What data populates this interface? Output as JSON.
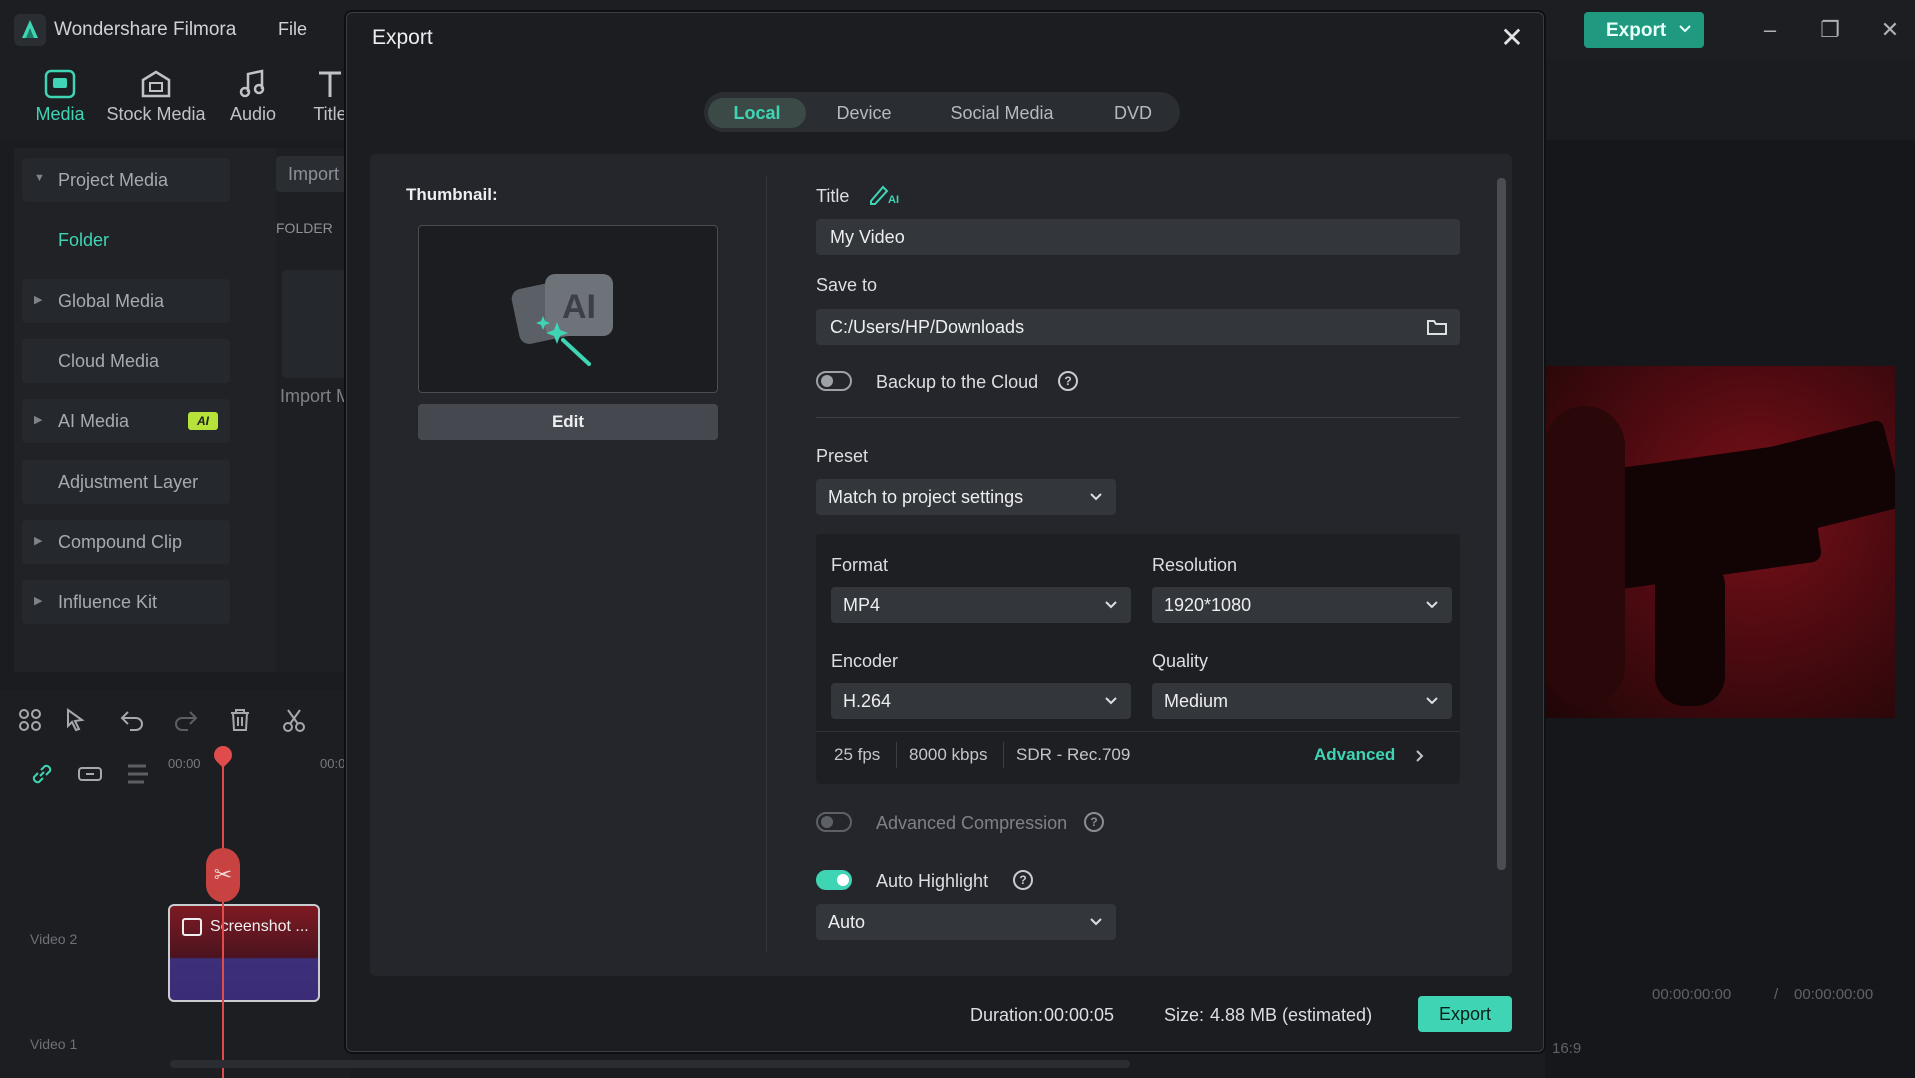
{
  "app": {
    "title": "Wondershare Filmora",
    "menu_file": "File",
    "top_export_label": "Export"
  },
  "toolbar": {
    "items": [
      {
        "label": "Media",
        "icon": "media-icon"
      },
      {
        "label": "Stock Media",
        "icon": "stock-media-icon"
      },
      {
        "label": "Audio",
        "icon": "music-note-icon"
      },
      {
        "label": "Title",
        "icon": "title-icon"
      }
    ]
  },
  "sidebar": {
    "items": [
      {
        "label": "Project Media"
      },
      {
        "label": "Folder"
      },
      {
        "label": "Global Media"
      },
      {
        "label": "Cloud Media"
      },
      {
        "label": "AI Media",
        "badge": "AI"
      },
      {
        "label": "Adjustment Layer"
      },
      {
        "label": "Compound Clip"
      },
      {
        "label": "Influence Kit"
      }
    ],
    "import_label": "Import",
    "folder_label": "FOLDER",
    "import_media_label": "Import M"
  },
  "timeline": {
    "ruler_start": "00:00",
    "ruler_next": "00:0",
    "clip_label": "Screenshot ...",
    "track_video2": "Video 2",
    "track_video1": "Video 1",
    "time_current": "00:00:00:00",
    "time_separator": "/",
    "time_total": "00:00:00:00",
    "ratio_label": "16:9"
  },
  "dialog": {
    "title": "Export",
    "tabs": [
      {
        "label": "Local",
        "active": true
      },
      {
        "label": "Device",
        "active": false
      },
      {
        "label": "Social Media",
        "active": false
      },
      {
        "label": "DVD",
        "active": false
      }
    ],
    "thumbnail_label": "Thumbnail:",
    "edit_label": "Edit",
    "title_label": "Title",
    "title_value": "My Video",
    "save_to_label": "Save to",
    "save_to_value": "C:/Users/HP/Downloads",
    "backup_label": "Backup to the Cloud",
    "preset_label": "Preset",
    "preset_value": "Match to project settings",
    "format_label": "Format",
    "format_value": "MP4",
    "resolution_label": "Resolution",
    "resolution_value": "1920*1080",
    "encoder_label": "Encoder",
    "encoder_value": "H.264",
    "quality_label": "Quality",
    "quality_value": "Medium",
    "fps": "25 fps",
    "bitrate": "8000 kbps",
    "color_space": "SDR - Rec.709",
    "advanced_label": "Advanced",
    "adv_compression_label": "Advanced Compression",
    "auto_highlight_label": "Auto Highlight",
    "auto_highlight_on": true,
    "auto_value": "Auto",
    "duration_label": "Duration:",
    "duration_value": "00:00:05",
    "size_label": "Size:",
    "size_value": "4.88 MB (estimated)",
    "export_label": "Export"
  },
  "colors": {
    "accent": "#3fd5b4",
    "export_top": "#1f9a80",
    "dialog_bg": "#1b1d21",
    "panel_bg": "#24262b"
  }
}
